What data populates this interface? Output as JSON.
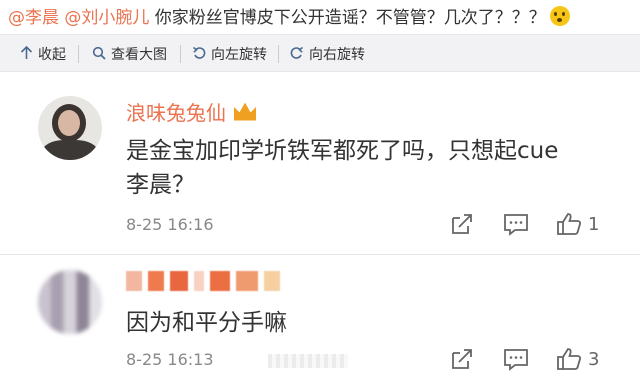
{
  "post": {
    "mention1": "@李晨",
    "mention2": "@刘小腕儿",
    "text": " 你家粉丝官博皮下公开造谣？不管管？几次了？？？",
    "emoji": "thinking-face-emoji"
  },
  "toolbar": {
    "collapse": "收起",
    "view_large": "查看大图",
    "rotate_left": "向左旋转",
    "rotate_right": "向右旋转"
  },
  "comments": [
    {
      "username": "浪味兔兔仙",
      "badge": "crown-icon",
      "text_line1": "是金宝加印学圻铁军都死了吗，只想起cue",
      "text_line2": "李晨？",
      "time": "8-25 16:16",
      "likes": "1"
    },
    {
      "username": "",
      "text_line1": "因为和平分手嘛",
      "time": "8-25 16:13",
      "likes": "3"
    }
  ],
  "colors": {
    "accent": "#eb7350",
    "toolbar_bg": "#f2f2f5",
    "icon_blue": "#4b6a8f"
  }
}
